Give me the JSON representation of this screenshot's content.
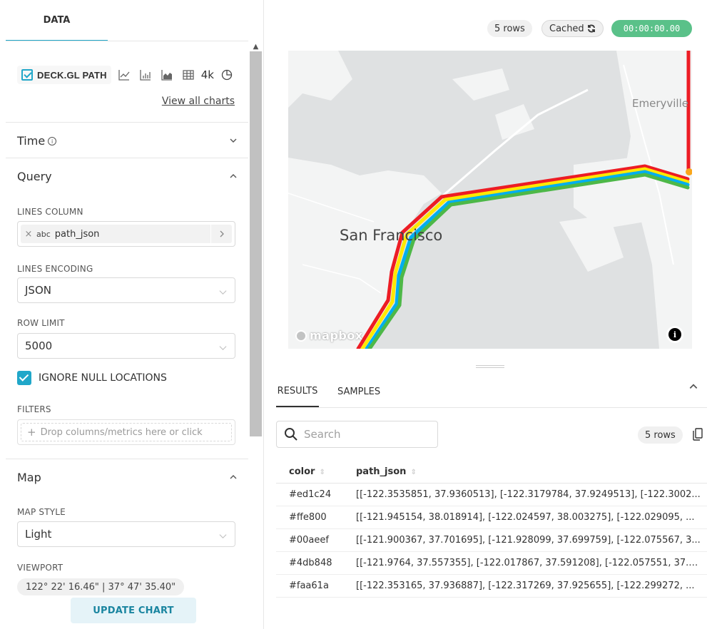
{
  "left_panel": {
    "tab": "DATA",
    "viz": {
      "selected_label": "DECK.GL PATH",
      "icons": [
        "line-chart-icon",
        "bar-chart-icon",
        "area-chart-icon",
        "table-icon"
      ],
      "big_number_label": "4k",
      "view_all_link": "View all charts"
    },
    "sections": {
      "time": "Time",
      "query": "Query",
      "map": "Map"
    },
    "fields": {
      "lines_column_label": "LINES COLUMN",
      "lines_column_type": "abc",
      "lines_column_value": "path_json",
      "lines_encoding_label": "LINES ENCODING",
      "lines_encoding_value": "JSON",
      "row_limit_label": "ROW LIMIT",
      "row_limit_value": "5000",
      "ignore_null_label": "IGNORE NULL LOCATIONS",
      "filters_label": "FILTERS",
      "filters_placeholder": "Drop columns/metrics here or click",
      "map_style_label": "MAP STYLE",
      "map_style_value": "Light",
      "viewport_label": "VIEWPORT",
      "viewport_value": "122° 22' 16.46\" | 37° 47' 35.40\""
    },
    "update_button": "UPDATE CHART"
  },
  "header": {
    "rows_badge": "5 rows",
    "cached_badge": "Cached",
    "timer": "00:00:00.00"
  },
  "map": {
    "label_city": "San Francisco",
    "label_emeryville": "Emeryville",
    "attribution": "mapbox",
    "info_glyph": "i",
    "path_colors": [
      "#ed1c24",
      "#ffe800",
      "#00aeef",
      "#4db848",
      "#faa61a"
    ]
  },
  "results": {
    "tab_results": "RESULTS",
    "tab_samples": "SAMPLES",
    "search_placeholder": "Search",
    "rows_badge": "5 rows",
    "columns": [
      "color",
      "path_json"
    ],
    "rows": [
      [
        "#ed1c24",
        "[[-122.3535851, 37.9360513], [-122.3179784, 37.9249513], [-122.3002..."
      ],
      [
        "#ffe800",
        "[[-121.945154, 38.018914], [-122.024597, 38.003275], [-122.029095, ..."
      ],
      [
        "#00aeef",
        "[[-121.900367, 37.701695], [-121.928099, 37.699759], [-122.075567, 3..."
      ],
      [
        "#4db848",
        "[[-121.9764, 37.557355], [-122.017867, 37.591208], [-122.057551, 37.6..."
      ],
      [
        "#faa61a",
        "[[-122.353165, 37.936887], [-122.317269, 37.925655], [-122.299272, ..."
      ]
    ]
  },
  "colors": {
    "accent": "#20a7c9",
    "success": "#5ac189"
  }
}
